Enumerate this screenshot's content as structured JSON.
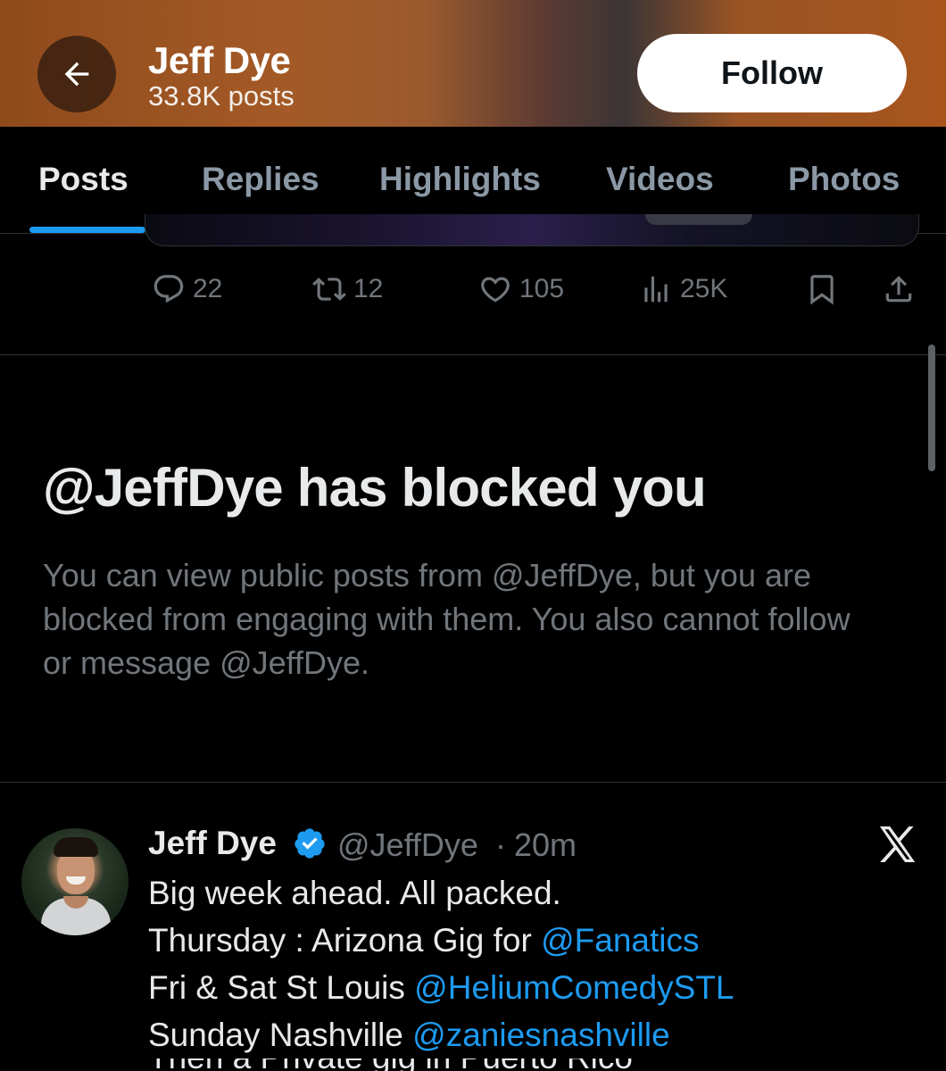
{
  "header": {
    "title": "Jeff Dye",
    "subtitle": "33.8K posts",
    "follow_label": "Follow",
    "back_icon": "arrow-left-icon"
  },
  "tabs": [
    {
      "label": "Posts",
      "active": true
    },
    {
      "label": "Replies",
      "active": false
    },
    {
      "label": "Highlights",
      "active": false
    },
    {
      "label": "Videos",
      "active": false
    },
    {
      "label": "Photos",
      "active": false
    }
  ],
  "actions": {
    "replies": "22",
    "reposts": "12",
    "likes": "105",
    "views": "25K"
  },
  "blocked": {
    "title": "@JeffDye has blocked you",
    "message": "You can view public posts from @JeffDye, but you are blocked from engaging with them. You also cannot follow or message @JeffDye."
  },
  "tweet": {
    "name": "Jeff Dye",
    "handle": "@JeffDye",
    "separator": "·",
    "time": "20m",
    "lines": [
      {
        "text": "Big week ahead. All packed.",
        "mention": ""
      },
      {
        "text": "Thursday : Arizona Gig for ",
        "mention": "@Fanatics"
      },
      {
        "text": "Fri & Sat St Louis ",
        "mention": "@HeliumComedySTL"
      },
      {
        "text": "Sunday Nashville ",
        "mention": "@zaniesnashville"
      }
    ],
    "cutoff_line": "Then a Private gig in Puerto Rico"
  },
  "colors": {
    "accent": "#1d9bf0",
    "muted": "#71767b",
    "background": "#000000",
    "verified": "#1d9bf0"
  }
}
